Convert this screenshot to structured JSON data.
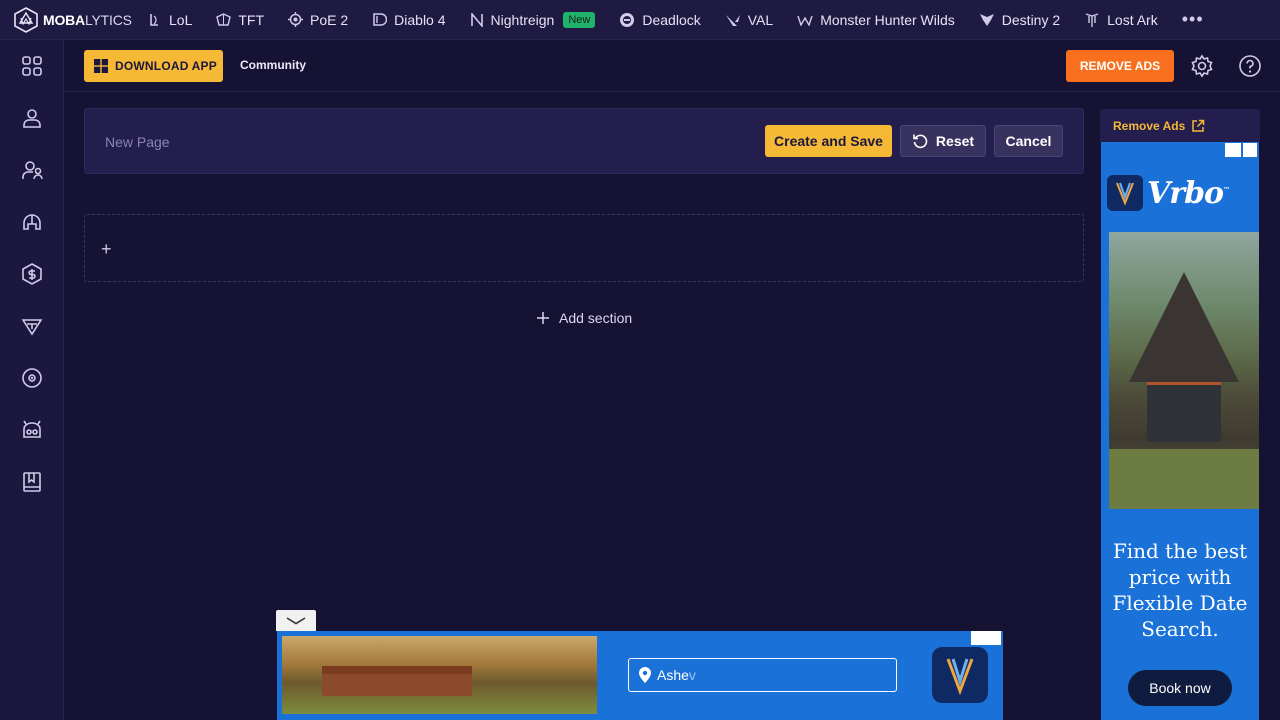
{
  "brand": {
    "name_bold": "MOBA",
    "name_thin": "LYTICS"
  },
  "games": [
    {
      "label": "LoL",
      "icon": "lol-icon"
    },
    {
      "label": "TFT",
      "icon": "tft-icon"
    },
    {
      "label": "PoE 2",
      "icon": "poe2-icon"
    },
    {
      "label": "Diablo 4",
      "icon": "diablo4-icon"
    },
    {
      "label": "Nightreign",
      "icon": "nightreign-icon",
      "badge": "New"
    },
    {
      "label": "Deadlock",
      "icon": "deadlock-icon"
    },
    {
      "label": "VAL",
      "icon": "valorant-icon"
    },
    {
      "label": "Monster Hunter Wilds",
      "icon": "mhw-icon"
    },
    {
      "label": "Destiny 2",
      "icon": "destiny2-icon"
    },
    {
      "label": "Lost Ark",
      "icon": "lostark-icon"
    }
  ],
  "more_label": "•••",
  "subheader": {
    "download_label": "DOWNLOAD APP",
    "community_label": "Community",
    "remove_ads_label": "REMOVE ADS"
  },
  "editor": {
    "page_name_placeholder": "New Page",
    "page_name_value": "",
    "create_label": "Create and Save",
    "reset_label": "Reset",
    "cancel_label": "Cancel",
    "section_plus": "+",
    "add_section_label": "Add section"
  },
  "ad_right": {
    "header_label": "Remove Ads",
    "brand": "Vrbo",
    "brand_mark": "™",
    "copy": "Find the best price with Flexible Date Search.",
    "cta": "Book now"
  },
  "ad_bottom": {
    "search_typed": "Ashe",
    "search_ghost": "v"
  },
  "colors": {
    "accent_yellow": "#f5b935",
    "accent_orange": "#f86f1e",
    "new_badge": "#1fb46a",
    "page_bg": "#161234",
    "ad_blue": "#1a71d8"
  }
}
